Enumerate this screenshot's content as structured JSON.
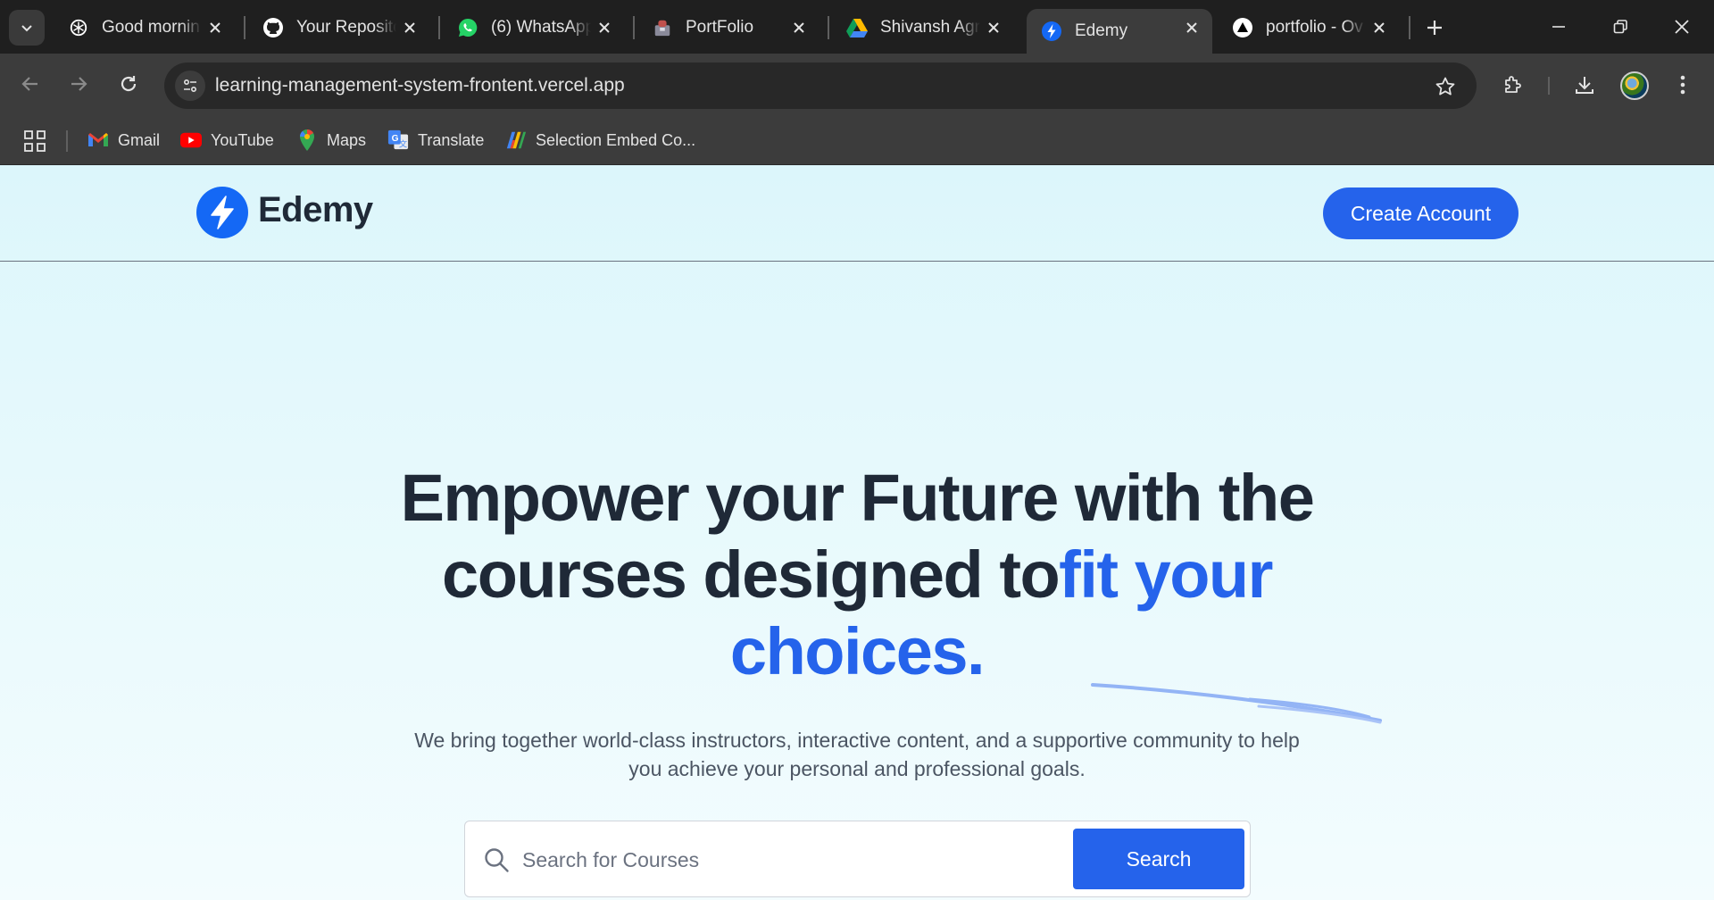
{
  "browser": {
    "tabs": [
      {
        "title": "Good mornin",
        "icon": "chatgpt-icon",
        "active": false
      },
      {
        "title": "Your Reposito",
        "icon": "github-icon",
        "active": false
      },
      {
        "title": "(6) WhatsApp",
        "icon": "whatsapp-icon",
        "active": false
      },
      {
        "title": "PortFolio",
        "icon": "portfolio-icon",
        "active": false
      },
      {
        "title": "Shivansh Agr",
        "icon": "google-drive-icon",
        "active": false
      },
      {
        "title": "Edemy",
        "icon": "edemy-bolt-icon",
        "active": true
      },
      {
        "title": "portfolio - Ov",
        "icon": "vercel-icon",
        "active": false
      }
    ],
    "url": "learning-management-system-frontent.vercel.app",
    "bookmarks": [
      {
        "label": "Gmail",
        "icon": "gmail-icon"
      },
      {
        "label": "YouTube",
        "icon": "youtube-icon"
      },
      {
        "label": "Maps",
        "icon": "maps-icon"
      },
      {
        "label": "Translate",
        "icon": "translate-icon"
      },
      {
        "label": "Selection Embed Co...",
        "icon": "selection-embed-icon"
      }
    ]
  },
  "site": {
    "logo_text": "Edemy",
    "create_account_label": "Create Account",
    "hero": {
      "title_part1": "Empower your Future with the courses designed to",
      "title_accent": "fit your choices.",
      "subtitle": "We bring together world-class instructors, interactive content, and a supportive community to help you achieve your personal and professional goals."
    },
    "search": {
      "placeholder": "Search for Courses",
      "value": "",
      "button_label": "Search"
    }
  },
  "colors": {
    "accent": "#2563eb",
    "heading": "#1f2937",
    "page_bg": "#dcf6fb",
    "browser_dark": "#1f1f1f",
    "toolbar": "#3c3c3c"
  }
}
